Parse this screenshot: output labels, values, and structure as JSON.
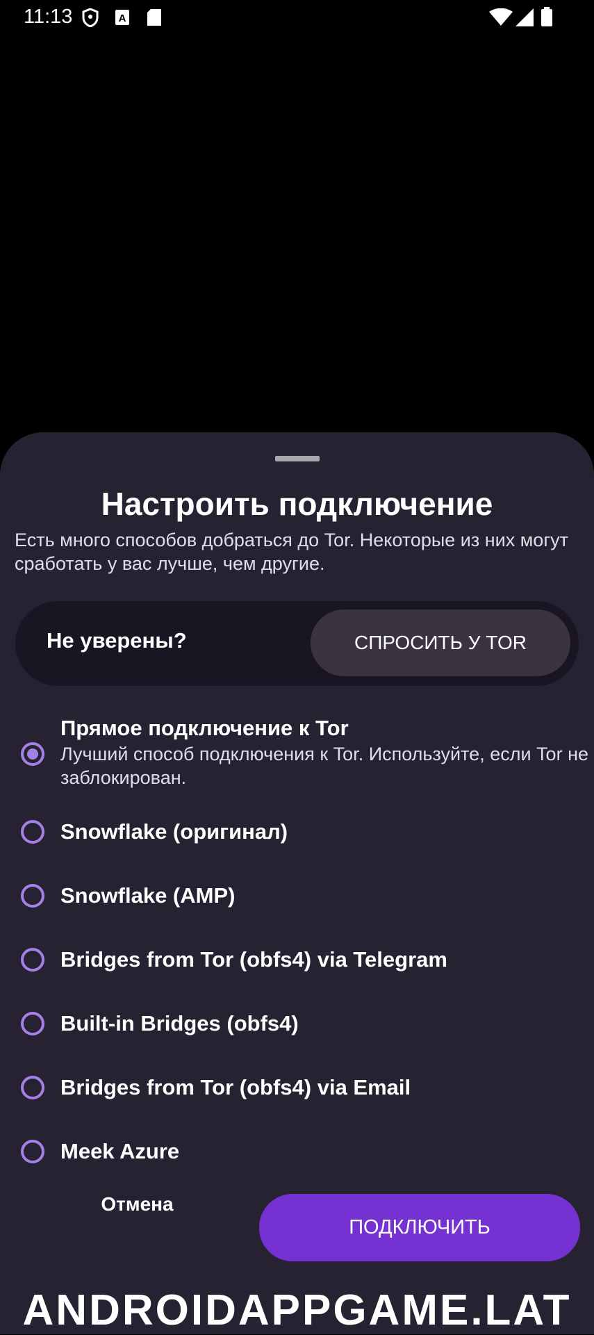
{
  "status_bar": {
    "time": "11:13",
    "icons": [
      "shield-icon",
      "font-a-icon",
      "sd-card-icon",
      "wifi-icon",
      "signal-icon",
      "battery-icon"
    ]
  },
  "sheet": {
    "title": "Настроить подключение",
    "subtitle": "Есть много способов добраться до Tor. Некоторые из них могут сработать у вас лучше, чем другие.",
    "unsure": {
      "label": "Не уверены?",
      "button": "СПРОСИТЬ У TOR"
    },
    "options": [
      {
        "label": "Прямое подключение к Tor",
        "description": "Лучший способ подключения к Tor. Используйте, если Tor не заблокирован.",
        "selected": true
      },
      {
        "label": "Snowflake (оригинал)",
        "selected": false
      },
      {
        "label": "Snowflake (AMP)",
        "selected": false
      },
      {
        "label": "Bridges from Tor (obfs4) via Telegram",
        "selected": false
      },
      {
        "label": "Built-in Bridges (obfs4)",
        "selected": false
      },
      {
        "label": "Bridges from Tor (obfs4) via Email",
        "selected": false
      },
      {
        "label": "Meek Azure",
        "selected": false
      }
    ],
    "cancel_label": "Отмена",
    "connect_label": "ПОДКЛЮЧИТЬ"
  },
  "watermark": "ANDROIDAPPGAME.LAT",
  "colors": {
    "sheet_bg": "#272232",
    "accent": "#7531d2",
    "radio": "#a47fe6"
  }
}
